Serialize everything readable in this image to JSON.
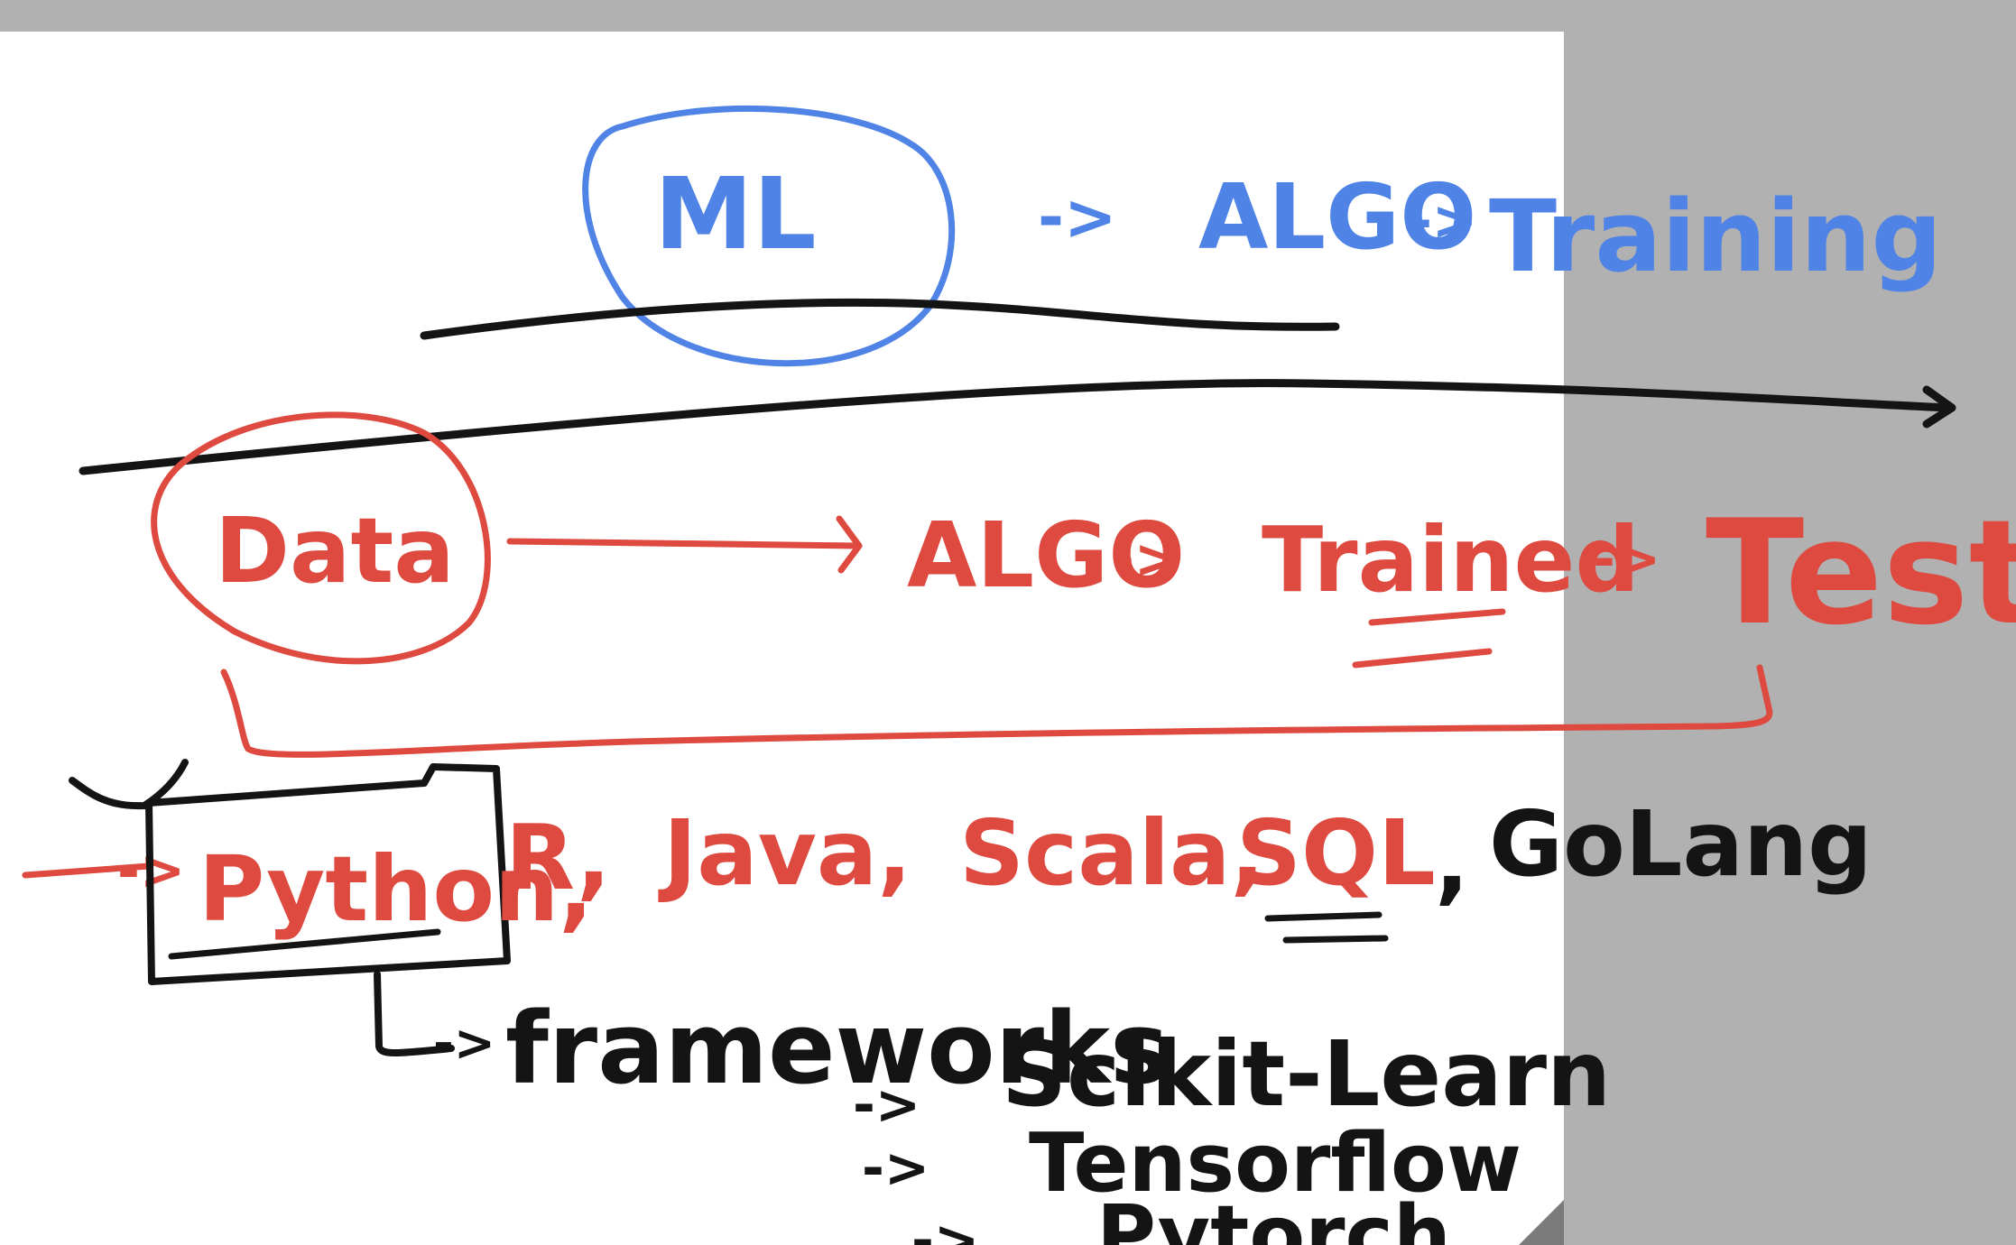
{
  "colors": {
    "background": "#b1b1b1",
    "page": "#ffffff",
    "blue": "#4f83e6",
    "red": "#de4a3f",
    "black": "#141414"
  },
  "top": {
    "ml": "ML",
    "algo": "ALGO",
    "arrow": "->",
    "training": "Training"
  },
  "flow": {
    "data": "Data",
    "algo": "ALGO",
    "arrow": "->",
    "trained": "Trained",
    "test": "Test"
  },
  "languages": {
    "arrow": "->",
    "python": "Python,",
    "r": "R,",
    "java": "Java,",
    "scala": "Scala,",
    "sql": "SQL",
    "comma": ",",
    "golang": "GoLang"
  },
  "frameworks": {
    "arrow": "->",
    "label": "frameworks",
    "items": [
      "Scikit-Learn",
      "Tensorflow",
      "Pytorch"
    ]
  }
}
